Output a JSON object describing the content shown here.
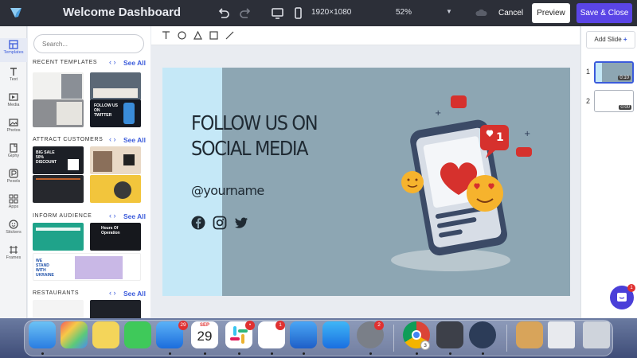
{
  "header": {
    "title": "Welcome Dashboard",
    "resolution": "1920×1080",
    "zoom": "52%",
    "cancel_label": "Cancel",
    "preview_label": "Preview",
    "save_label": "Save & Close"
  },
  "rail": {
    "items": [
      {
        "label": "Templates",
        "icon": "templates-icon"
      },
      {
        "label": "Text",
        "icon": "text-icon"
      },
      {
        "label": "Media",
        "icon": "media-icon"
      },
      {
        "label": "Photos",
        "icon": "photos-icon"
      },
      {
        "label": "Giphy",
        "icon": "giphy-icon"
      },
      {
        "label": "Pexels",
        "icon": "pexels-icon"
      },
      {
        "label": "Apps",
        "icon": "apps-icon"
      },
      {
        "label": "Stickers",
        "icon": "stickers-icon"
      },
      {
        "label": "Frames",
        "icon": "frames-icon"
      }
    ]
  },
  "panel": {
    "search_placeholder": "Search...",
    "see_all": "See All",
    "sections": [
      {
        "title": "RECENT TEMPLATES"
      },
      {
        "title": "ATTRACT CUSTOMERS"
      },
      {
        "title": "INFORM AUDIENCE"
      },
      {
        "title": "RESTAURANTS"
      }
    ],
    "thumb_texts": {
      "follow": "FOLLOW US ON TWITTER",
      "big_sale": "BIG SALE 50% DISCOUNT",
      "hours": "Hours Of Operation",
      "ukraine": "WE STAND WITH UKRAINE"
    }
  },
  "slide": {
    "heading_line1": "FOLLOW US ON",
    "heading_line2": "SOCIAL MEDIA",
    "handle": "@yourname",
    "like_count": "1"
  },
  "slides_panel": {
    "add_label": "Add Slide",
    "slides": [
      {
        "number": "1",
        "duration": "0:10"
      },
      {
        "number": "2",
        "duration": "0:00"
      }
    ]
  },
  "chat": {
    "badge": "1"
  },
  "dock": {
    "mail_badge": "29",
    "slack_badge": "•",
    "reminders_badge": "1",
    "settings_badge": "2",
    "calendar_month": "SEP",
    "calendar_day": "29",
    "chrome_badge": "3"
  },
  "colors": {
    "topbar": "#2c2f38",
    "accent": "#5a45e6",
    "link": "#3b5bdb",
    "slide_bg": "#8da6b3",
    "slide_left": "#c5e8f7"
  }
}
